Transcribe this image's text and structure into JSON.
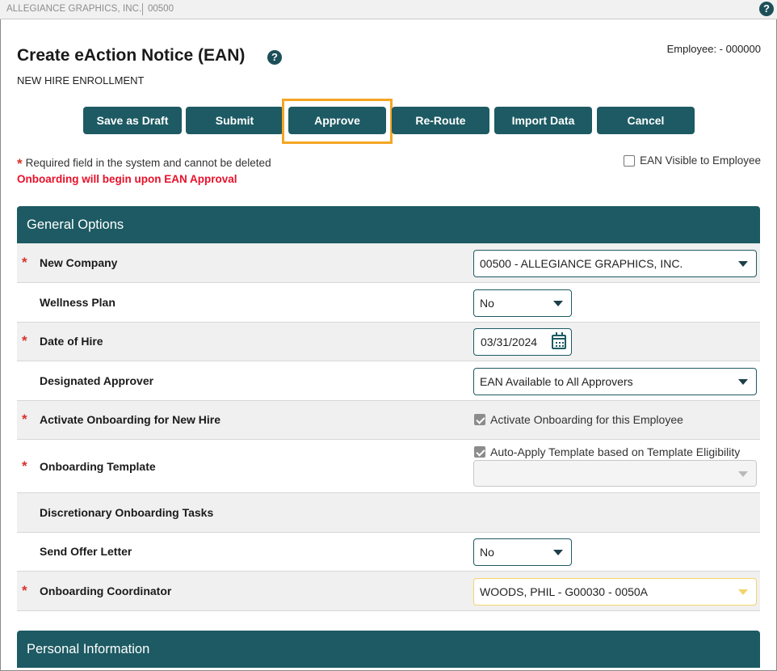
{
  "topbar": {
    "company": "ALLEGIANCE GRAPHICS, INC.",
    "code": "00500",
    "help_icon": "?"
  },
  "header": {
    "title": "Create eAction Notice (EAN)",
    "help_icon": "?",
    "subtitle": "NEW HIRE ENROLLMENT",
    "employee": "Employee: - 000000"
  },
  "toolbar": {
    "save_draft": "Save as Draft",
    "submit": "Submit",
    "approve": "Approve",
    "reroute": "Re-Route",
    "import": "Import Data",
    "cancel": "Cancel"
  },
  "notes": {
    "required_star": "*",
    "required_text": "Required field in the system and cannot be deleted",
    "onboarding_warning": "Onboarding will begin upon EAN Approval",
    "visible_label": "EAN Visible to Employee"
  },
  "general": {
    "header": "General Options",
    "star": "*",
    "new_company": {
      "label": "New Company",
      "value": "00500 - ALLEGIANCE GRAPHICS, INC."
    },
    "wellness": {
      "label": "Wellness Plan",
      "value": "No"
    },
    "hire_date": {
      "label": "Date of Hire",
      "value": "03/31/2024"
    },
    "approver": {
      "label": "Designated Approver",
      "value": "EAN Available to All Approvers"
    },
    "activate": {
      "label": "Activate Onboarding for New Hire",
      "check_label": "Activate Onboarding for this Employee"
    },
    "template": {
      "label": "Onboarding Template",
      "check_label": "Auto-Apply Template based on Template Eligibility",
      "value": ""
    },
    "discretionary": {
      "label": "Discretionary Onboarding Tasks"
    },
    "offer": {
      "label": "Send Offer Letter",
      "value": "No"
    },
    "coordinator": {
      "label": "Onboarding Coordinator",
      "value": "WOODS, PHIL - G00030 - 0050A"
    }
  },
  "personal": {
    "header": "Personal Information"
  }
}
